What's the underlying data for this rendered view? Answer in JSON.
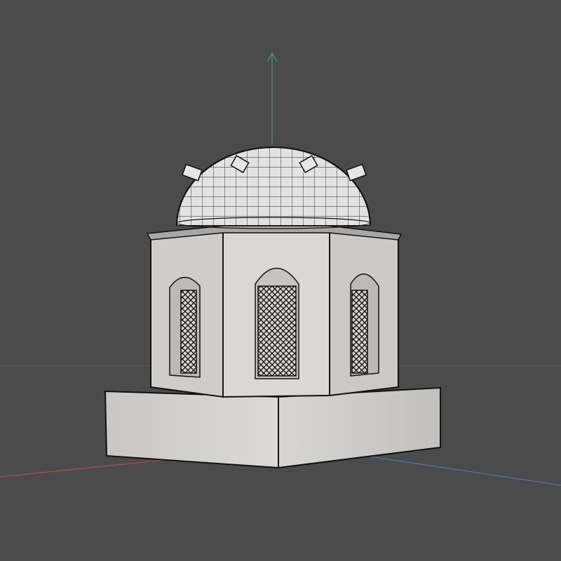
{
  "viewport": {
    "background_color": "#4b4b4b",
    "axis_colors": {
      "y": "#3fae6a",
      "x": "#c04848",
      "z": "#4a7ec0"
    },
    "model_fill": "#d6d4d0",
    "wire_color": "#111111",
    "icons": [
      "y-axis-arrow-icon"
    ]
  }
}
